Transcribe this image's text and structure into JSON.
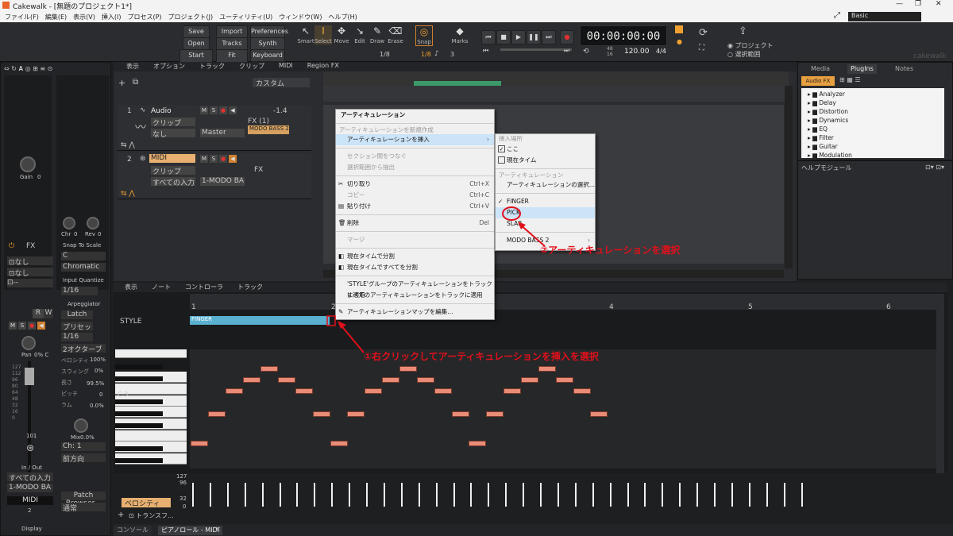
{
  "window": {
    "title": "Cakewalk - [無題のプロジェクト1*]",
    "workspace": "Basic"
  },
  "menubar": [
    "ファイル(F)",
    "編集(E)",
    "表示(V)",
    "挿入(I)",
    "プロセス(P)",
    "プロジェクト(J)",
    "ユーティリティ(U)",
    "ウィンドウ(W)",
    "ヘルプ(H)"
  ],
  "control": {
    "buttons": [
      "Save",
      "Import",
      "Preferences",
      "Open",
      "Tracks",
      "Synth Rack",
      "Start Screen",
      "Fit Project",
      "Keyboard"
    ],
    "tools": [
      "Smart",
      "Select",
      "Move",
      "Edit",
      "Draw",
      "Erase",
      "Snap",
      "Marks"
    ],
    "snap_value": "1/8",
    "snap_value2": "1/8",
    "snap_count": "3",
    "time": "00:00:00:00",
    "tempo": "120.00",
    "meter": "4/4",
    "beats": "48",
    "sub": "16",
    "radio1": "プロジェクト",
    "radio2": "選択範囲",
    "logo": "cakewalk"
  },
  "tracks": [
    {
      "num": "1",
      "name": "Audio",
      "clip": "クリップ",
      "input": "なし",
      "output": "Master",
      "fx": "FX (1)",
      "plugin": "MODO BASS 2",
      "level": "-1.4"
    },
    {
      "num": "2",
      "name": "MIDI",
      "clip": "クリップ",
      "input": "すべての入力",
      "output": "1-MODO BA",
      "fx": "FX"
    }
  ],
  "trackview_menu": [
    "表示",
    "オプション",
    "トラック",
    "クリップ",
    "MIDI",
    "Region FX"
  ],
  "custom": "カスタム",
  "context_menu": {
    "title": "アーティキュレーション",
    "section": "アーティキュレーションを新規作成",
    "items": [
      {
        "label": "アーティキュレーションを挿入",
        "shortcut": ""
      },
      {
        "label": "セクション間をつなぐ",
        "shortcut": ""
      },
      {
        "label": "選択範囲から抽出",
        "shortcut": ""
      },
      {
        "label": "切り取り",
        "shortcut": "Ctrl+X"
      },
      {
        "label": "コピー",
        "shortcut": "Ctrl+C"
      },
      {
        "label": "貼り付け",
        "shortcut": "Ctrl+V"
      },
      {
        "label": "削除",
        "shortcut": "Del"
      },
      {
        "label": "マージ",
        "shortcut": ""
      },
      {
        "label": "現在タイムで分割",
        "shortcut": ""
      },
      {
        "label": "現在タイムですべてを分割",
        "shortcut": ""
      },
      {
        "label": "'STYLE'グループのアーティキュレーションをトラックに適用",
        "shortcut": ""
      },
      {
        "label": "すべてのアーティキュレーションをトラックに適用",
        "shortcut": ""
      },
      {
        "label": "アーティキュレーションマップを編集...",
        "shortcut": ""
      }
    ]
  },
  "submenu": {
    "section1": "挿入場所",
    "here": "ここ",
    "current_time": "現在タイム",
    "section2": "アーティキュレーション",
    "choose": "アーティキュレーションの選択...",
    "items": [
      "FINGER",
      "PICK",
      "SLAP",
      "MODO BASS 2"
    ]
  },
  "annotations": {
    "a1": "①右クリックしてアーティキュレーションを挿入を選択",
    "a2": "②アーティキュレーションを選択"
  },
  "pianoroll": {
    "menu": [
      "表示",
      "ノート",
      "コントローラ",
      "トラック"
    ],
    "style_label": "STYLE",
    "clip_label": "FINGER",
    "c3": "C 3",
    "ruler": [
      "1",
      "2",
      "3",
      "4",
      "5",
      "6"
    ],
    "vel_label": "ベロシティ",
    "vel_max": "127",
    "vel_96": "96",
    "vel_32": "32",
    "vel_0": "0",
    "transform": "トランスフ..."
  },
  "inspector": {
    "gain": "Gain",
    "gain_val": "0",
    "chr": "Chr",
    "chr_val": "0",
    "rev": "Rev",
    "rev_val": "0",
    "fx": "FX",
    "snap_to_scale": "Snap To Scale",
    "scale_root": "C",
    "scale_type": "Chromatic",
    "input_quantize": "Input Quantize",
    "quant_val": "1/16",
    "arp": "Arpeggiator",
    "latch": "Latch",
    "preset": "プリセット...",
    "rate": "1/16",
    "octave": "2オクターブ",
    "velocity": "ベロシティ",
    "vel_pct": "100%",
    "swing": "スウィング",
    "swing_pct": "0%",
    "length": "長さ",
    "length_pct": "99.5%",
    "pitch": "ピッチ",
    "pitch_val": "0",
    "ramp": "ラム",
    "ramp_val": "0.0%",
    "pan": "Pan",
    "pan_val": "0% C",
    "mix": "Mix",
    "mix_val": "0.0%",
    "ch": "Ch: 1",
    "dir": "前方向",
    "fader_val": "101",
    "in_out": "In / Out",
    "in_sel": "すべての入力",
    "out_sel": "1-MODO BA",
    "midi": "MIDI",
    "midi_num": "2",
    "patch": "Patch Browser...",
    "normal": "通常",
    "display": "Display",
    "none1": "なし",
    "none2": "なし",
    "scale_vals": [
      "127",
      "112",
      "96",
      "80",
      "64",
      "48",
      "32",
      "16",
      "0"
    ]
  },
  "right_panel": {
    "tabs": [
      "Media",
      "PlugIns",
      "Notes"
    ],
    "audio_fx": "Audio FX",
    "tree": [
      "Analyzer",
      "Delay",
      "Distortion",
      "Dynamics",
      "EQ",
      "Filter",
      "Guitar",
      "Modulation"
    ],
    "help": "ヘルプモジュール"
  },
  "bottom_tabs": [
    "コンソール",
    "ピアノロール - MIDI"
  ]
}
